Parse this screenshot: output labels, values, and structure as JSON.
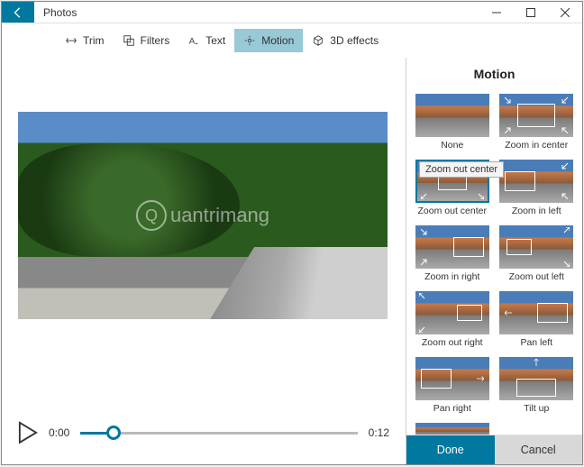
{
  "app_title": "Photos",
  "toolbar": {
    "trim": "Trim",
    "filters": "Filters",
    "text": "Text",
    "motion": "Motion",
    "effects": "3D effects"
  },
  "watermark": "uantrimang",
  "playback": {
    "current": "0:00",
    "duration": "0:12"
  },
  "sidebar": {
    "title": "Motion",
    "done": "Done",
    "cancel": "Cancel",
    "tooltip": "Zoom out center",
    "items": [
      {
        "label": "None"
      },
      {
        "label": "Zoom in center"
      },
      {
        "label": "Zoom out center"
      },
      {
        "label": "Zoom in left"
      },
      {
        "label": "Zoom in right"
      },
      {
        "label": "Zoom out left"
      },
      {
        "label": "Zoom out right"
      },
      {
        "label": "Pan left"
      },
      {
        "label": "Pan right"
      },
      {
        "label": "Tilt up"
      }
    ]
  }
}
